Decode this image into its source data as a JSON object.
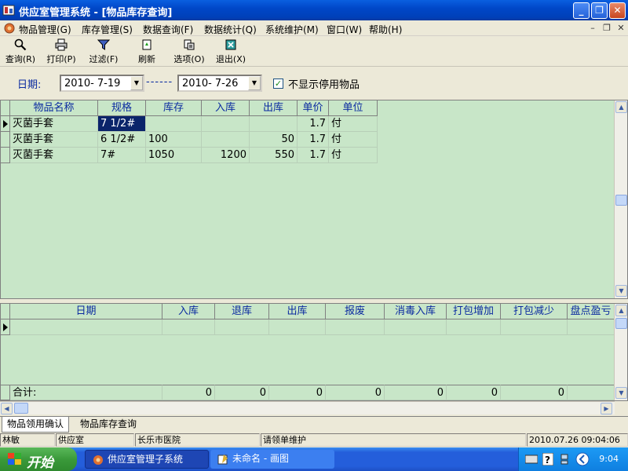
{
  "window": {
    "title": "供应室管理系统 - [物品库存查询]",
    "min_label": "_",
    "max_label": "❐",
    "close_label": "✕"
  },
  "menu": {
    "items": [
      {
        "label": "物品管理(G)"
      },
      {
        "label": "库存管理(S)"
      },
      {
        "label": "数据查询(F)"
      },
      {
        "label": "数据统计(Q)"
      },
      {
        "label": "系统维护(M)"
      },
      {
        "label": "窗口(W)"
      },
      {
        "label": "帮助(H)"
      }
    ],
    "mdi_min": "–",
    "mdi_restore": "❐",
    "mdi_close": "✕"
  },
  "toolbar": {
    "query": "查询(R)",
    "print": "打印(P)",
    "filter": "过滤(F)",
    "refresh": "刷新",
    "options": "选项(O)",
    "exit": "退出(X)"
  },
  "filter": {
    "date_label": "日期:",
    "start_date": "2010- 7-19",
    "separator": "------",
    "end_date": "2010- 7-26",
    "hide_disabled_checked": "✓",
    "hide_disabled_label": "不显示停用物品"
  },
  "top_grid": {
    "columns": [
      "物品名称",
      "规格",
      "库存",
      "入库",
      "出库",
      "单价",
      "单位"
    ],
    "rows": [
      [
        "灭菌手套",
        "7 1/2#",
        "",
        "",
        "",
        "1.7",
        "付"
      ],
      [
        "灭菌手套",
        "6 1/2#",
        "100",
        "",
        "50",
        "1.7",
        "付"
      ],
      [
        "灭菌手套",
        "7#",
        "1050",
        "1200",
        "550",
        "1.7",
        "付"
      ]
    ]
  },
  "bottom_grid": {
    "columns": [
      "日期",
      "入库",
      "退库",
      "出库",
      "报废",
      "消毒入库",
      "打包增加",
      "打包减少",
      "盘点盈亏"
    ],
    "total_label": "合计:",
    "totals": [
      "0",
      "0",
      "0",
      "0",
      "0",
      "0",
      "0"
    ]
  },
  "tabs": [
    {
      "label": "物品领用确认"
    },
    {
      "label": "物品库存查询"
    }
  ],
  "status": {
    "user": "林敏",
    "dept": "供应室",
    "hospital": "长乐市医院",
    "hint": "请领单维护",
    "datetime": "2010.07.26 09:04:06"
  },
  "taskbar": {
    "start": "开始",
    "tasks": [
      {
        "label": "供应室管理子系统"
      },
      {
        "label": "未命名 - 画图"
      }
    ],
    "clock": "9:04"
  },
  "colors": {
    "grid_bg": "#c8e6c8",
    "header_text": "#0a2aa0",
    "selection": "#0a246a",
    "titlebar": "#0047c8"
  }
}
